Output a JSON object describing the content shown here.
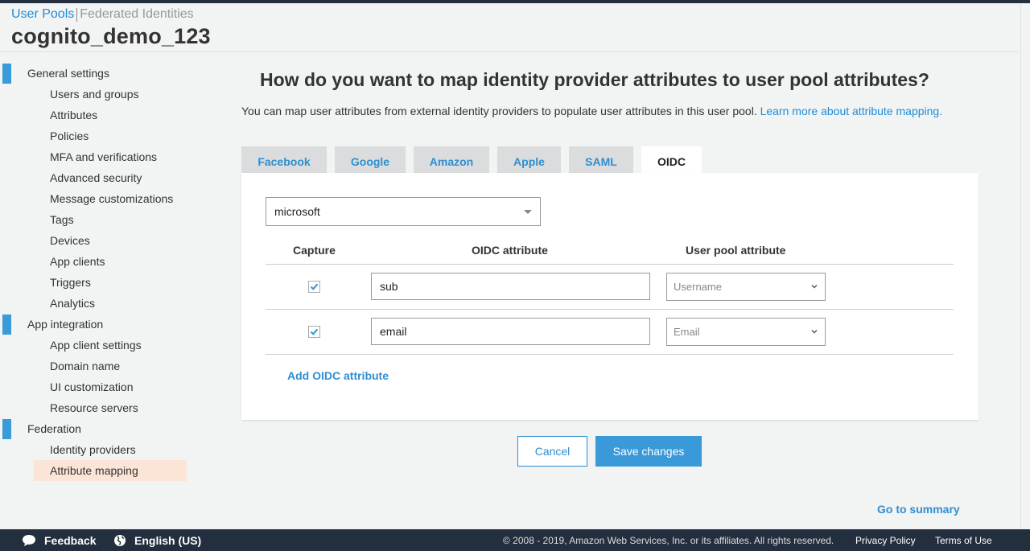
{
  "header": {
    "breadcrumb_user_pools": "User Pools",
    "breadcrumb_federated": "Federated Identities",
    "pool_name": "cognito_demo_123"
  },
  "sidebar": {
    "sections": [
      {
        "label": "General settings",
        "items": [
          "Users and groups",
          "Attributes",
          "Policies",
          "MFA and verifications",
          "Advanced security",
          "Message customizations",
          "Tags",
          "Devices",
          "App clients",
          "Triggers",
          "Analytics"
        ]
      },
      {
        "label": "App integration",
        "items": [
          "App client settings",
          "Domain name",
          "UI customization",
          "Resource servers"
        ]
      },
      {
        "label": "Federation",
        "items": [
          "Identity providers",
          "Attribute mapping"
        ]
      }
    ],
    "active_item": "Attribute mapping"
  },
  "main": {
    "title": "How do you want to map identity provider attributes to user pool attributes?",
    "description": "You can map user attributes from external identity providers to populate user attributes in this user pool.",
    "learn_more": "Learn more about attribute mapping."
  },
  "tabs": [
    {
      "label": "Facebook",
      "active": false
    },
    {
      "label": "Google",
      "active": false
    },
    {
      "label": "Amazon",
      "active": false
    },
    {
      "label": "Apple",
      "active": false
    },
    {
      "label": "SAML",
      "active": false
    },
    {
      "label": "OIDC",
      "active": true
    }
  ],
  "panel": {
    "provider_selected": "microsoft",
    "columns": {
      "capture": "Capture",
      "oidc": "OIDC attribute",
      "pool": "User pool attribute"
    },
    "rows": [
      {
        "capture": true,
        "oidc_value": "sub",
        "pool_value": "Username"
      },
      {
        "capture": true,
        "oidc_value": "email",
        "pool_value": "Email"
      }
    ],
    "add_label": "Add OIDC attribute"
  },
  "actions": {
    "cancel": "Cancel",
    "save": "Save changes",
    "go_summary": "Go to summary"
  },
  "footer": {
    "feedback": "Feedback",
    "language": "English (US)",
    "copyright": "© 2008 - 2019, Amazon Web Services, Inc. or its affiliates. All rights reserved.",
    "privacy": "Privacy Policy",
    "terms": "Terms of Use"
  },
  "colors": {
    "accent": "#3a9ad9",
    "link": "#1f8dd6",
    "active_nav": "#fbe5d6",
    "footer_bg": "#232f3e"
  }
}
